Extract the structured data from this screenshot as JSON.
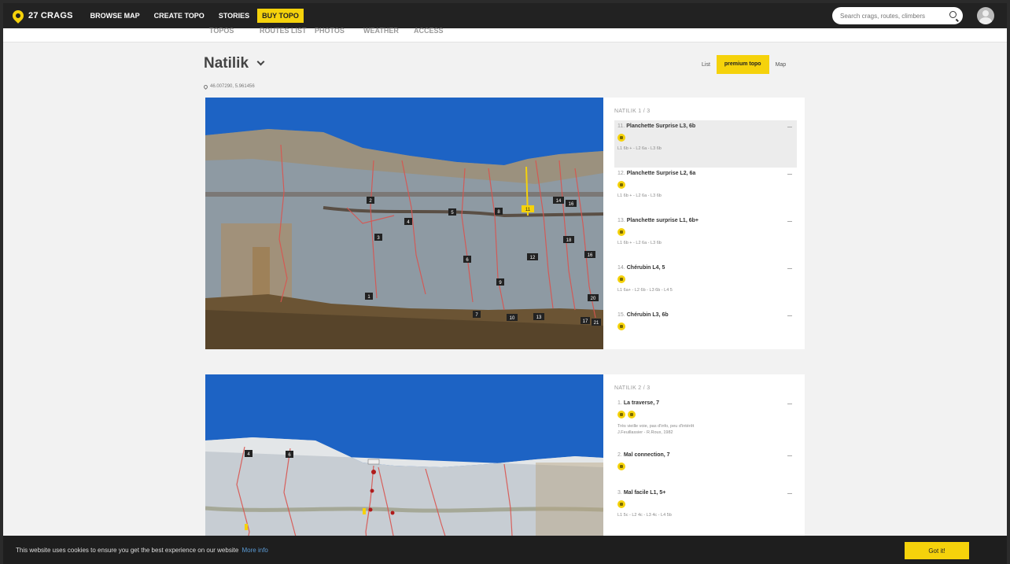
{
  "nav": {
    "brand": "27 CRAGS",
    "links": [
      "BROWSE MAP",
      "CREATE TOPO",
      "STORIES"
    ],
    "buy": "BUY TOPO",
    "search_placeholder": "Search crags, routes, climbers"
  },
  "subtabs": [
    "TOPOS",
    "ROUTES LIST",
    "PHOTOS",
    "WEATHER",
    "ACCESS"
  ],
  "crag": {
    "name": "Natilik",
    "coords": "46.007290, 5.961456"
  },
  "view_tabs": {
    "list": "List",
    "premium": "premium topo",
    "map": "Map"
  },
  "topo1": {
    "label": "NATILIK 1 / 3",
    "routes": [
      {
        "num": "11.",
        "name": "Planchette Surprise L3, 6b",
        "pitches": "L1 6b + - L2 6a - L3 6b"
      },
      {
        "num": "12.",
        "name": "Planchette Surprise L2, 6a",
        "pitches": "L1 6b + - L2 6a - L3 6b"
      },
      {
        "num": "13.",
        "name": "Planchette surprise L1, 6b+",
        "pitches": "L1 6b + - L2 6a - L3 6b"
      },
      {
        "num": "14.",
        "name": "Chérubin L4, 5",
        "pitches": "L1 6a+ - L2 6b - L3 6b - L4 5"
      },
      {
        "num": "15.",
        "name": "Chérubin L3, 6b"
      }
    ],
    "markers": [
      "2",
      "4",
      "5",
      "3",
      "6",
      "8",
      "11",
      "14",
      "16",
      "18",
      "12",
      "16",
      "9",
      "1",
      "7",
      "10",
      "13",
      "20",
      "17",
      "21"
    ]
  },
  "topo2": {
    "label": "NATILIK 2 / 3",
    "routes": [
      {
        "num": "1.",
        "name": "La traverse, 7",
        "desc": "Très vieille voie, pas d'info, peu d'intérêt",
        "desc2": "J.Feuillassier - R.Roux, 1982"
      },
      {
        "num": "2.",
        "name": "Mal connection, 7"
      },
      {
        "num": "3.",
        "name": "Mal facile L1, 5+",
        "pitches": "L1 5c - L2 4c - L3 4c - L4 5b"
      }
    ],
    "markers": [
      "4",
      "6"
    ]
  },
  "cookie": {
    "text": "This website uses cookies to ensure you get the best experience on our website",
    "more": "More info",
    "button": "Got it!"
  },
  "colors": {
    "accent": "#f5d20b",
    "nav_bg": "#222222",
    "route_line": "#c0392b"
  }
}
